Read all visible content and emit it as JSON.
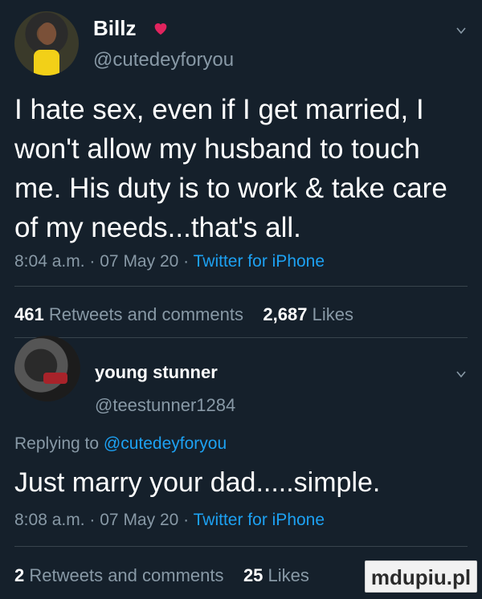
{
  "tweet": {
    "display_name": "Billz",
    "handle": "@cutedeyforyou",
    "text": "I hate sex, even if I get married, I won't allow my husband to touch me. His duty is to work  & take care of my needs...that's all.",
    "time": "8:04 a.m.",
    "date": "07 May 20",
    "source": "Twitter for iPhone",
    "retweets_count": "461",
    "retweets_label": "Retweets and comments",
    "likes_count": "2,687",
    "likes_label": "Likes"
  },
  "reply": {
    "display_name": "young stunner",
    "handle": "@teestunner1284",
    "replying_label": "Replying to",
    "replying_handle": "@cutedeyforyou",
    "text": "Just marry your dad.....simple.",
    "time": "8:08 a.m.",
    "date": "07 May 20",
    "source": "Twitter for iPhone",
    "retweets_count": "2",
    "retweets_label": "Retweets and comments",
    "likes_count": "25",
    "likes_label": "Likes"
  },
  "meta_separator": "·",
  "watermark": "mdupiu.pl",
  "colors": {
    "background": "#15202b",
    "secondary_text": "#8899a6",
    "link": "#1da1f2",
    "heart": "#e0245e",
    "divider": "#38444d"
  },
  "icons": [
    "heart-icon",
    "chevron-down-icon"
  ]
}
